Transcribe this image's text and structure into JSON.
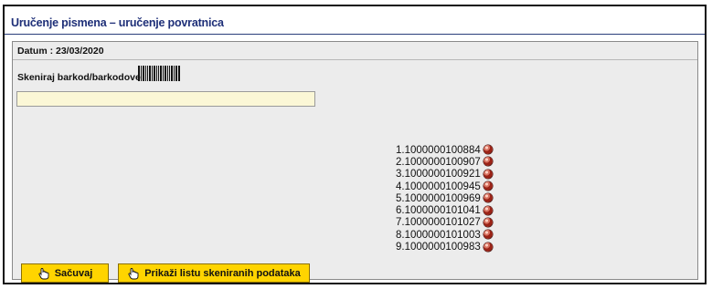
{
  "header": {
    "title": "Uručenje pismena – uručenje povratnica"
  },
  "form": {
    "date_label": "Datum : 23/03/2020",
    "scan_label": "Skeniraj barkod/barkodove",
    "scan_input_value": "",
    "scan_input_placeholder": ""
  },
  "scanned_items": [
    {
      "index": "1.",
      "code": "1000000100884",
      "status_icon": "status-dot-red-icon"
    },
    {
      "index": "2.",
      "code": "1000000100907",
      "status_icon": "status-dot-red-icon"
    },
    {
      "index": "3.",
      "code": "1000000100921",
      "status_icon": "status-dot-red-icon"
    },
    {
      "index": "4.",
      "code": "1000000100945",
      "status_icon": "status-dot-red-icon"
    },
    {
      "index": "5.",
      "code": "1000000100969",
      "status_icon": "status-dot-red-icon"
    },
    {
      "index": "6.",
      "code": "1000000101041",
      "status_icon": "status-dot-red-icon"
    },
    {
      "index": "7.",
      "code": "1000000101027",
      "status_icon": "status-dot-red-icon"
    },
    {
      "index": "8.",
      "code": "1000000101003",
      "status_icon": "status-dot-red-icon"
    },
    {
      "index": "9.",
      "code": "1000000100983",
      "status_icon": "status-dot-red-icon"
    }
  ],
  "buttons": {
    "save_label": "Sačuvaj",
    "show_list_label": "Prikaži listu skeniranih podataka",
    "icon": "hand-pointer-icon"
  },
  "colors": {
    "header_text": "#1e2f78",
    "panel_background": "#ececec",
    "input_background": "#fbf7d6",
    "button_background": "#ffd400"
  }
}
